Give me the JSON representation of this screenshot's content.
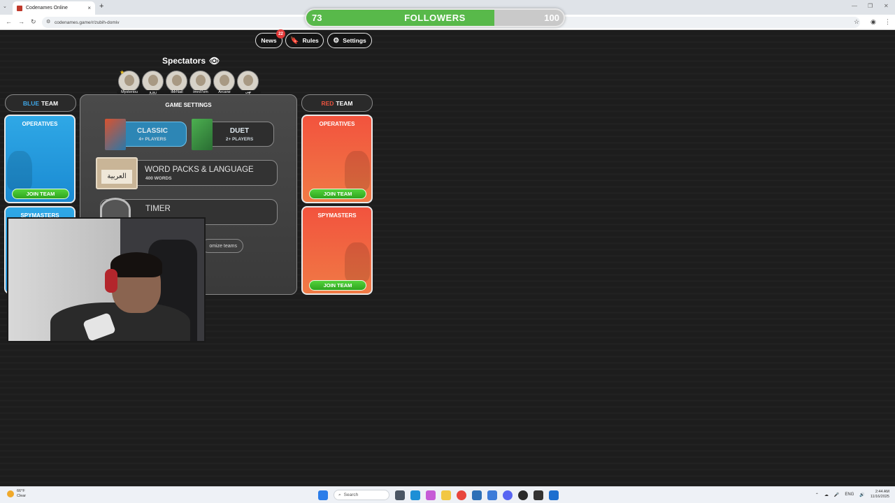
{
  "browser": {
    "tab_title": "Codenames Online",
    "url": "codenames.game/r/zubih-domiv",
    "new_tab": "+",
    "tab_close": "×"
  },
  "overlay": {
    "followers_label": "FOLLOWERS",
    "current": "73",
    "goal": "100",
    "progress_fraction": 0.73,
    "fill_color": "#58b94a"
  },
  "top_nav": {
    "news": "News",
    "news_badge": "22",
    "rules": "Rules",
    "settings": "Settings"
  },
  "spectators": {
    "title": "Spectators",
    "users": [
      "Mysteriou",
      "زوزو",
      "iMrNail",
      "imrd7om",
      "Arcane",
      "نهى"
    ]
  },
  "blue_team": {
    "prefix": "BLUE",
    "suffix": "TEAM",
    "color": "#2fa8e6",
    "operatives": "OPERATIVES",
    "spymasters": "SPYMASTERS",
    "join": "JOIN TEAM"
  },
  "red_team": {
    "prefix": "RED",
    "suffix": "TEAM",
    "color": "#f2533e",
    "operatives": "OPERATIVES",
    "spymasters": "SPYMASTERS",
    "join": "JOIN TEAM",
    "join2": "JOIN TEAM"
  },
  "game_settings": {
    "title": "GAME SETTINGS",
    "modes": [
      {
        "name": "CLASSIC",
        "players": "4+ PLAYERS",
        "selected": true
      },
      {
        "name": "DUET",
        "players": "2+ PLAYERS",
        "selected": false
      }
    ],
    "word_packs": {
      "title": "WORD PACKS & LANGUAGE",
      "sub": "400 WORDS",
      "lang_card": "العربية"
    },
    "timer": {
      "title": "TIMER"
    },
    "randomize": "omize teams"
  },
  "taskbar": {
    "temp": "66°F",
    "weather": "Clear",
    "search": "Search",
    "lang": "ENG",
    "time": "2:44 AM",
    "date": "11/16/2025"
  }
}
